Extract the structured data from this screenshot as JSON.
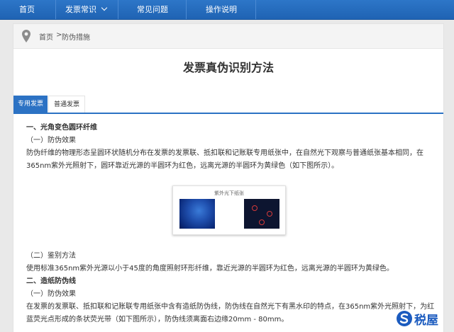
{
  "nav": {
    "items": [
      {
        "label": "首页"
      },
      {
        "label": "发票常识"
      },
      {
        "label": "常见问题"
      },
      {
        "label": "操作说明"
      }
    ]
  },
  "breadcrumb": {
    "home": "首页",
    "separator": ">",
    "current": "防伪措施"
  },
  "page_title": "发票真伪识别方法",
  "tabs": [
    {
      "label": "专用发票",
      "active": true
    },
    {
      "label": "普通发票",
      "active": false
    }
  ],
  "content": {
    "s1_heading": "一、光角变色圆环纤维",
    "s1_sub1": "（一）防伪效果",
    "s1_p1_line1": "防伪纤维的物理形态呈圆环状随机分布在发票的发票联、抵扣联和记账联专用纸张中，在自然光下观察与普通纸张基本相同，在",
    "s1_p1_line2": "365nm紫外光照射下，圆环靠近光源的半圆环为红色，远离光源的半圆环为黄绿色（如下图所示）。",
    "figure_caption": "紫外光下纸张",
    "s1_sub2": "（二）鉴别方法",
    "s1_p2": "使用标准365nm紫外光源以小于45度的角度照射环形纤维，靠近光源的半圆环为红色，远离光源的半圆环为黄绿色。",
    "s2_heading": "二、造纸防伪线",
    "s2_sub1": "（一）防伪效果",
    "s2_p1_line1": "在发票的发票联、抵扣联和记账联专用纸张中含有造纸防伪线，防伪线在自然光下有黑水印的特点，在365nm紫外光照射下，为红",
    "s2_p1_line2": "蓝荧光点形成的条状荧光带（如下图所示），防伪线须离面右边缘20mm - 80mm。"
  },
  "watermark": {
    "text": "税屋"
  },
  "colors": {
    "nav_bg": "#2268b8",
    "tab_active": "#2c72c4",
    "ring": "#d63a3a"
  },
  "icons": {
    "breadcrumb": "map-pin-icon",
    "nav_dropdown": "chevron-down-icon"
  }
}
